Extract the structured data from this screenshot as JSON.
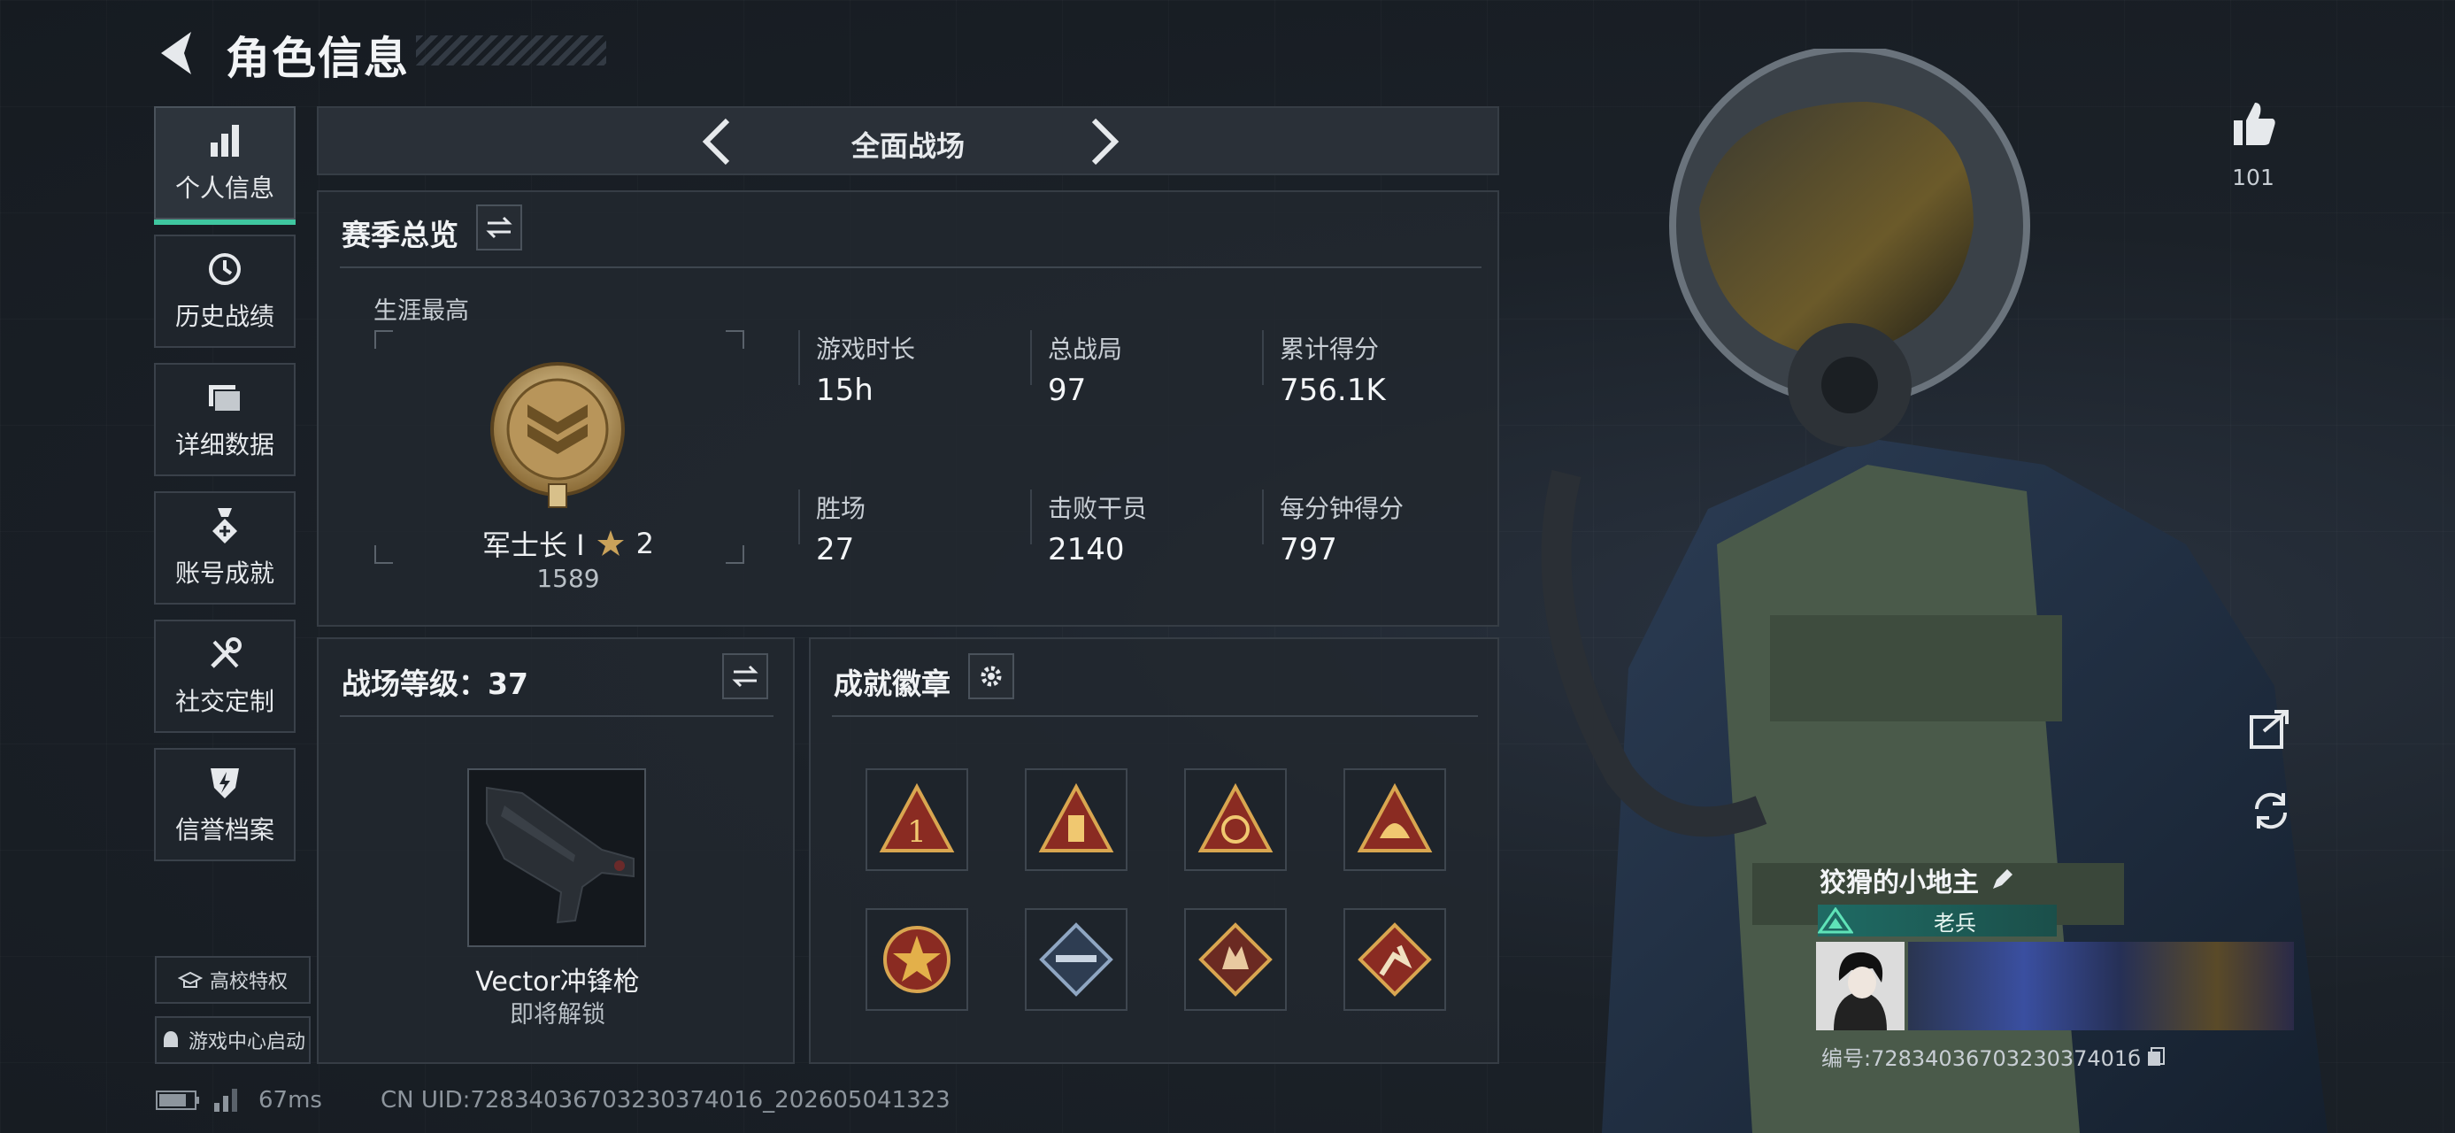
{
  "header": {
    "title": "角色信息"
  },
  "nav": {
    "items": [
      {
        "label": "个人信息",
        "icon": "bar-chart-icon",
        "active": true
      },
      {
        "label": "历史战绩",
        "icon": "history-icon"
      },
      {
        "label": "详细数据",
        "icon": "folder-icon"
      },
      {
        "label": "账号成就",
        "icon": "medal-icon"
      },
      {
        "label": "社交定制",
        "icon": "tools-icon"
      },
      {
        "label": "信誉档案",
        "icon": "shield-bolt-icon"
      }
    ],
    "campus_label": "高校特权",
    "game_center_label": "游戏中心启动"
  },
  "mode": {
    "label": "全面战场"
  },
  "season": {
    "title": "赛季总览",
    "career_best_label": "生涯最高",
    "rank_name": "军士长 I",
    "rank_stars": "2",
    "rank_points": "1589",
    "stats": [
      {
        "label": "游戏时长",
        "value": "15h"
      },
      {
        "label": "总战局",
        "value": "97"
      },
      {
        "label": "累计得分",
        "value": "756.1K"
      },
      {
        "label": "胜场",
        "value": "27"
      },
      {
        "label": "击败干员",
        "value": "2140"
      },
      {
        "label": "每分钟得分",
        "value": "797"
      }
    ]
  },
  "battle_level": {
    "title": "战场等级：37",
    "weapon_name": "Vector冲锋枪",
    "weapon_status": "即将解锁"
  },
  "achievements": {
    "title": "成就徽章",
    "badges": [
      "rank-1-badge-icon",
      "ammo-badge-icon",
      "target-badge-icon",
      "helmet-badge-icon",
      "star-wreath-badge-icon",
      "rifle-badge-icon",
      "wolf-badge-icon",
      "runner-badge-icon"
    ]
  },
  "profile": {
    "likes": "101",
    "player_name": "狡猾的小地主",
    "title_tag": "老兵",
    "player_id": "编号:7283403670323037401б"
  },
  "status_bar": {
    "ping": "67ms",
    "uid": "CN UID:72834036703230374016_202605041323"
  },
  "colors": {
    "accent": "#3fc7a0",
    "gold": "#c9a25a"
  }
}
